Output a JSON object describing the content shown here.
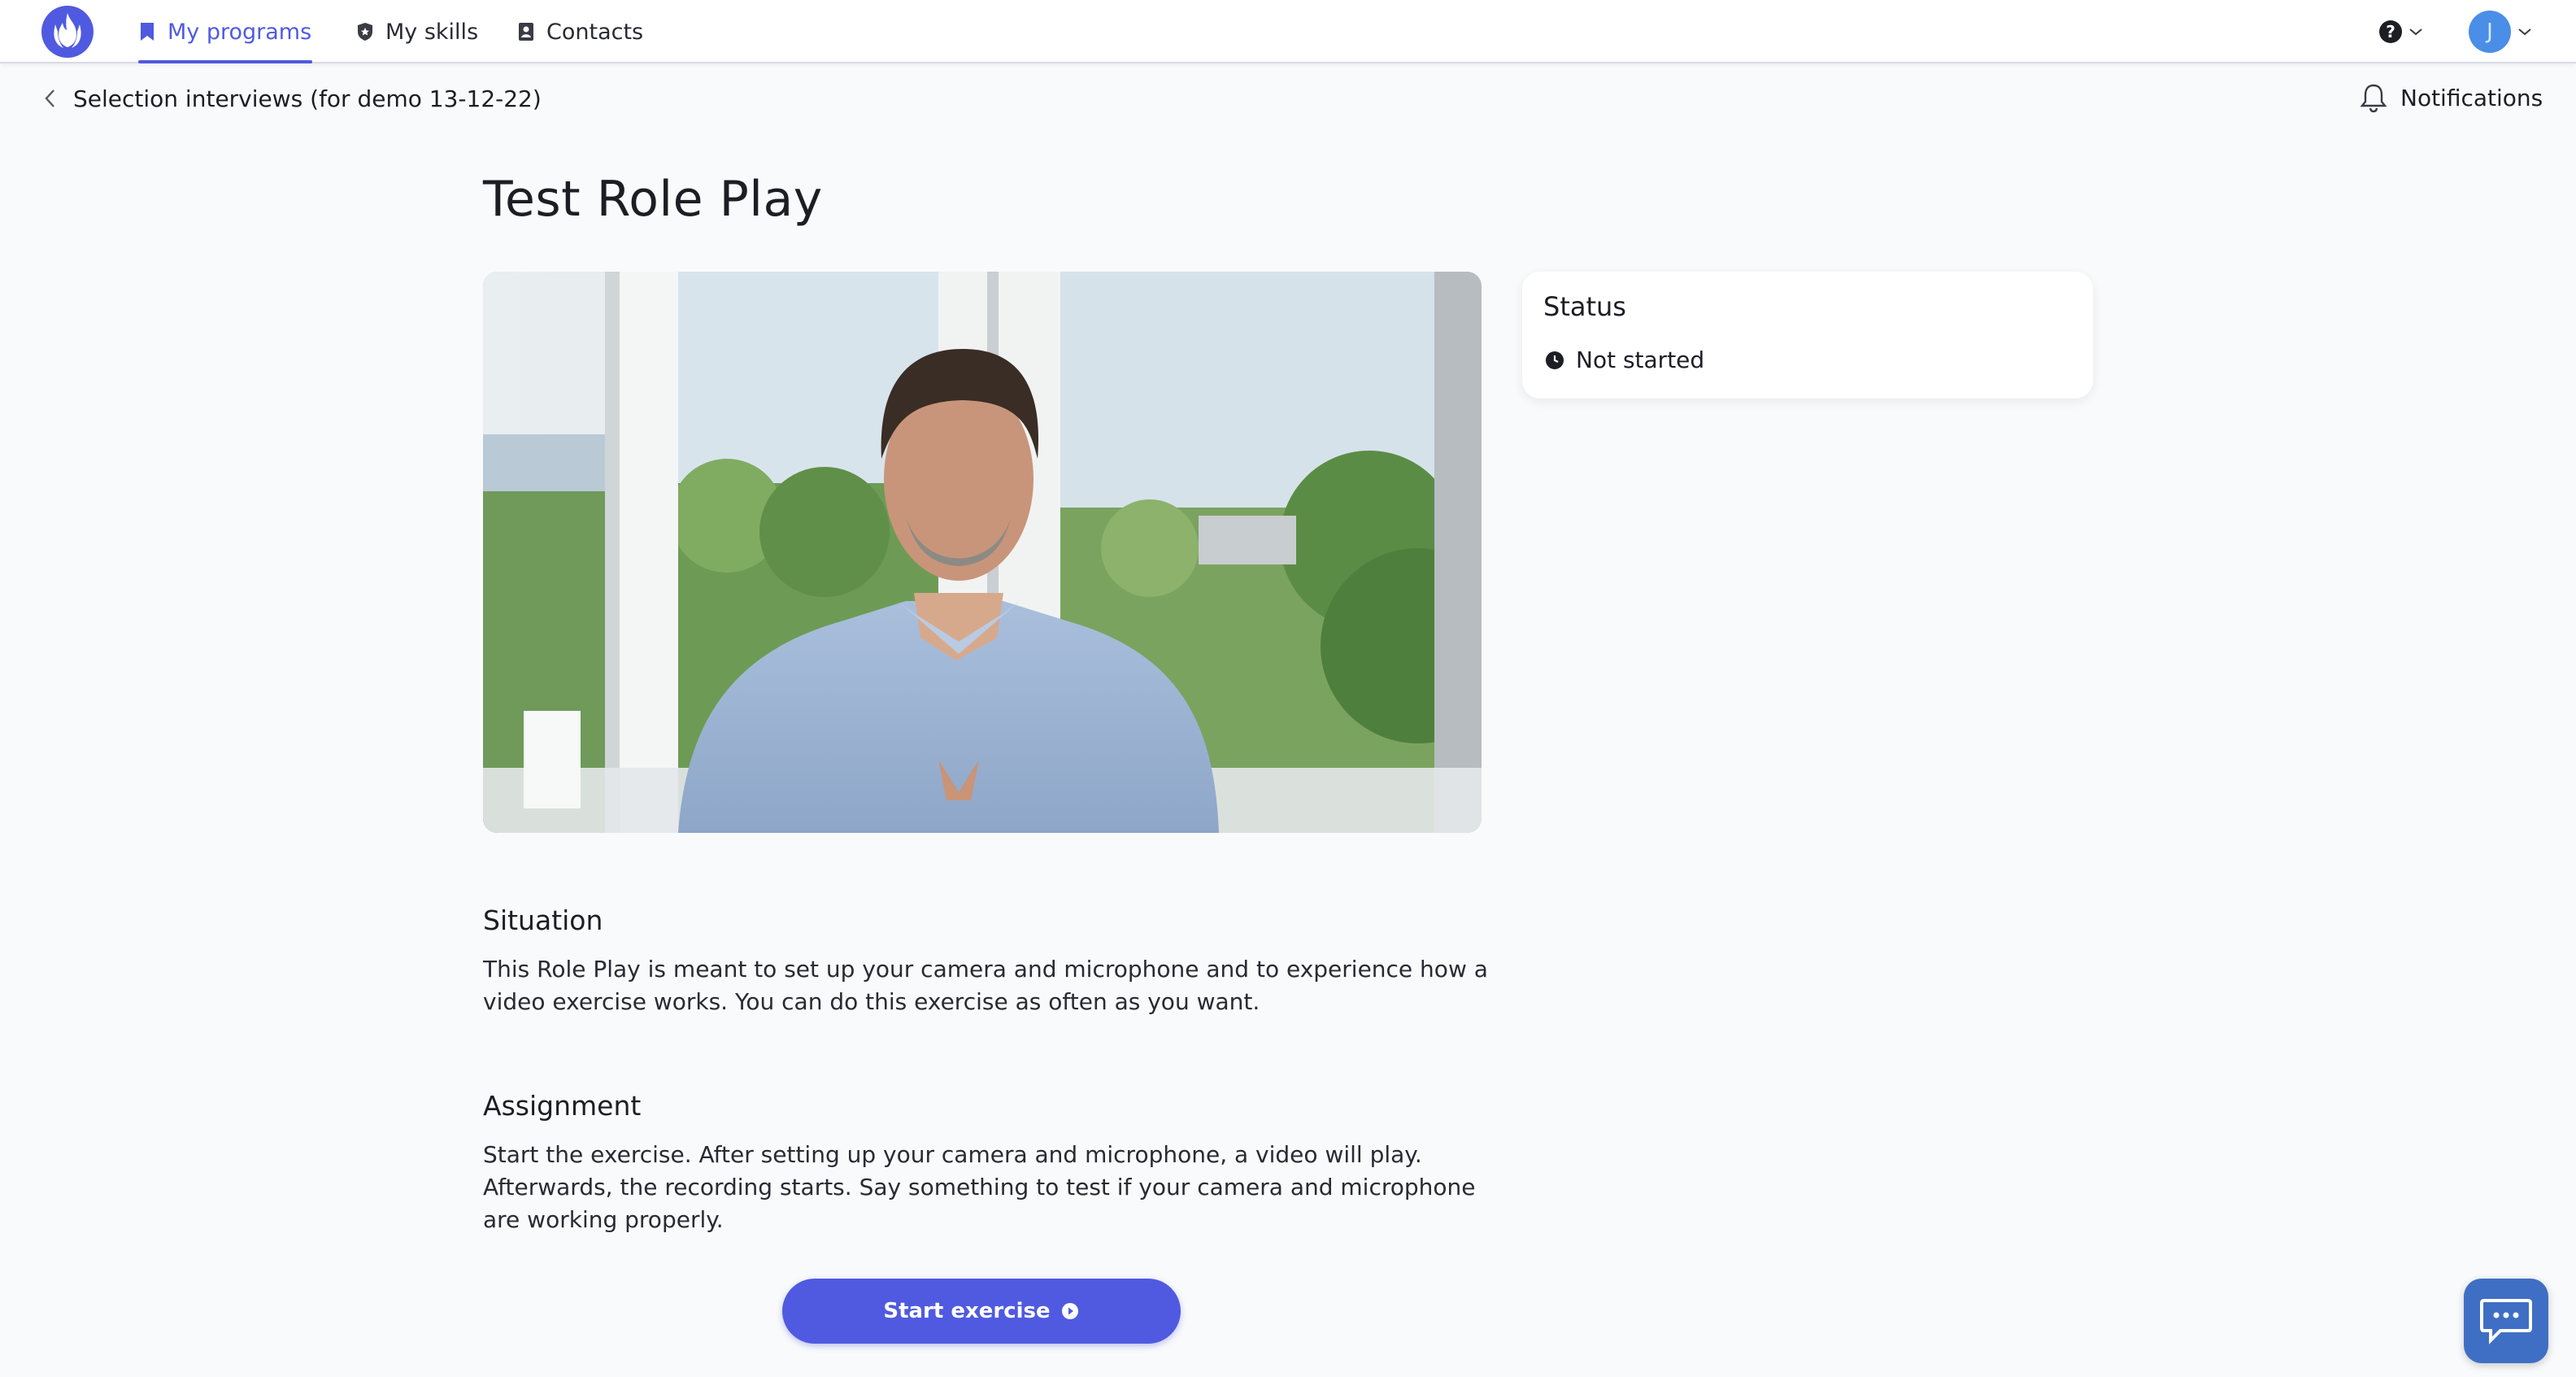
{
  "nav": {
    "tabs": [
      {
        "label": "My programs",
        "icon": "bookmark-icon",
        "active": true
      },
      {
        "label": "My skills",
        "icon": "shield-icon",
        "active": false
      },
      {
        "label": "Contacts",
        "icon": "contact-book-icon",
        "active": false
      }
    ],
    "help_icon": "?",
    "avatar_initial": "J"
  },
  "subheader": {
    "back_label": "Selection interviews (for demo 13-12-22)",
    "notifications_label": "Notifications"
  },
  "main": {
    "title": "Test Role Play",
    "status": {
      "title": "Status",
      "value": "Not started"
    },
    "situation": {
      "heading": "Situation",
      "text": "This Role Play is meant to set up your camera and microphone and to experience how a video exercise works. You can do this exercise as often as you want."
    },
    "assignment": {
      "heading": "Assignment",
      "text": "Start the exercise. After setting up your camera and microphone, a video will play. Afterwards, the recording starts. Say something to test if your camera and microphone are working properly."
    },
    "start_button": "Start exercise"
  },
  "colors": {
    "accent": "#4f5ae0",
    "avatar": "#4a8ee8",
    "chat": "#3f6fc4"
  }
}
